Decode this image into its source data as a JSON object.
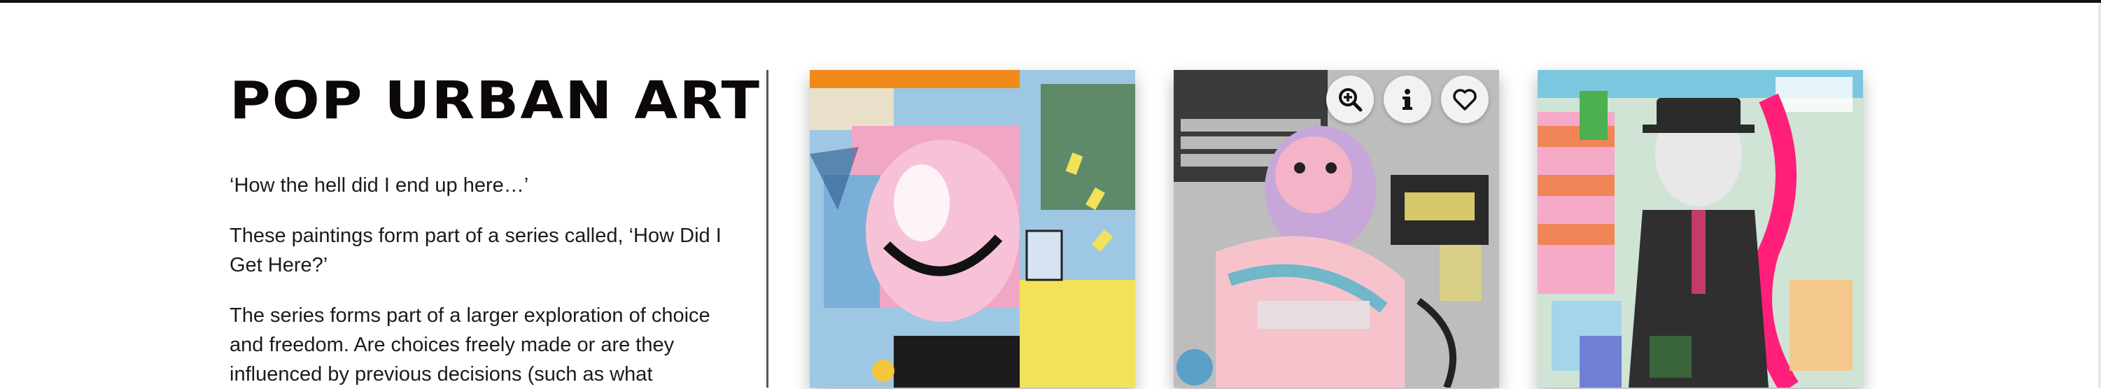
{
  "header": {
    "title": "POP URBAN ART"
  },
  "description": {
    "p1": "‘How the hell did I end up here…’",
    "p2_line1": "These paintings form part of a series called, ‘How Did I",
    "p2_line2": "Get Here?’",
    "p3_line1": "The series forms part of a larger exploration of choice",
    "p3_line2": "and freedom. Are choices freely made or are they",
    "p3_line3": "influenced by previous decisions (such as what"
  },
  "artworks": [
    {
      "name": "artwork-1"
    },
    {
      "name": "artwork-2"
    },
    {
      "name": "artwork-3"
    }
  ],
  "artwork_toolbar": {
    "icons": [
      "zoom-in-icon",
      "info-icon",
      "heart-icon"
    ]
  },
  "colors": {
    "title": "#0c0808",
    "text": "#1b1b1b",
    "divider": "#555555",
    "button_bg": "#f2f2f2"
  }
}
